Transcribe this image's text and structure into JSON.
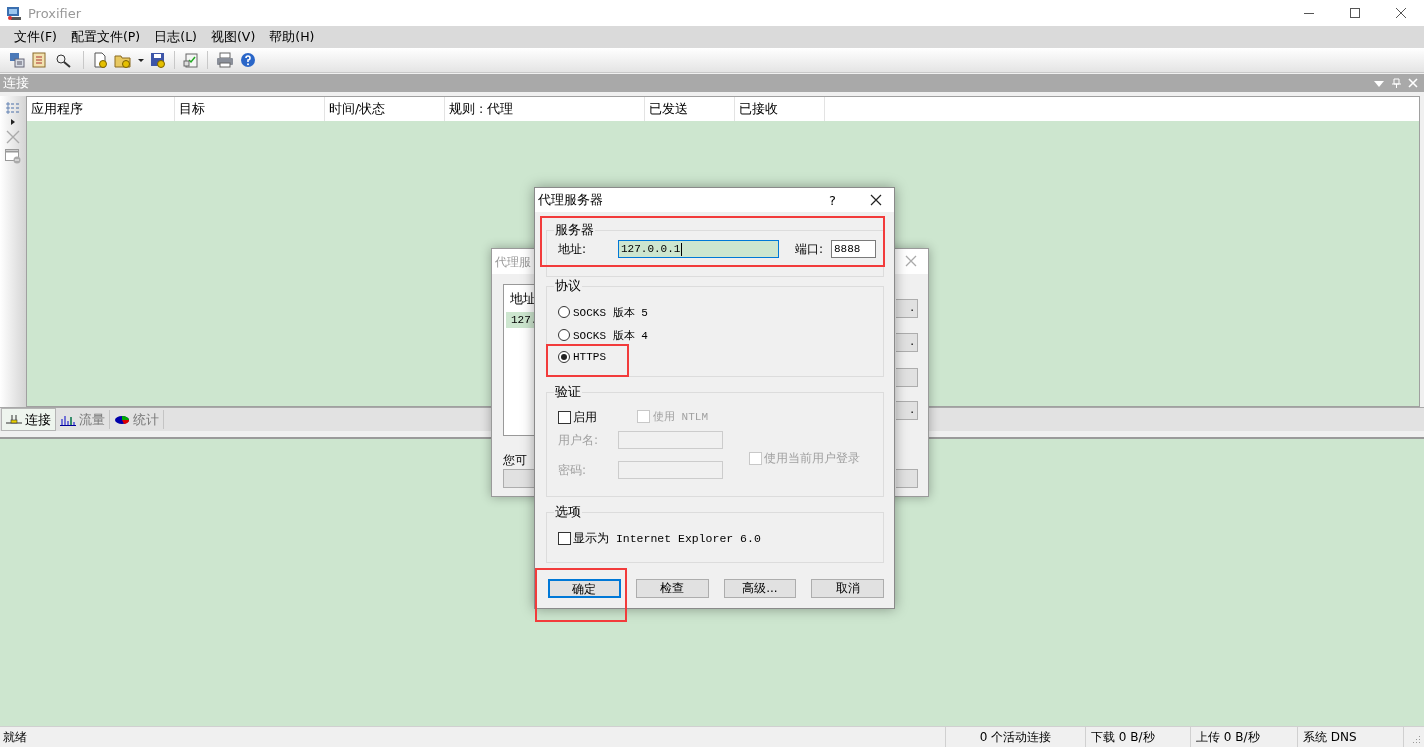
{
  "window": {
    "title": "Proxifier"
  },
  "menu": [
    "文件(F)",
    "配置文件(P)",
    "日志(L)",
    "视图(V)",
    "帮助(H)"
  ],
  "connections_panel": {
    "title": "连接",
    "columns": [
      "应用程序",
      "目标",
      "时间/状态",
      "规则 : 代理",
      "已发送",
      "已接收"
    ]
  },
  "tabs": [
    {
      "label": "连接",
      "selected": true
    },
    {
      "label": "流量",
      "selected": false
    },
    {
      "label": "统计",
      "selected": false
    }
  ],
  "background_dialog": {
    "title": "代理服",
    "list_header": "地址",
    "list_row": "127.",
    "text": "您可",
    "side_buttons": [
      {
        "kind": "labeled",
        "label": "."
      },
      {
        "kind": "labeled",
        "label": "."
      },
      {
        "kind": "blank"
      },
      {
        "kind": "labeled",
        "label": "."
      },
      {
        "kind": "blank"
      }
    ]
  },
  "proxy_dialog": {
    "title": "代理服务器",
    "help": "?",
    "server": {
      "title": "服务器",
      "highlighted": true,
      "address_label": "地址:",
      "address": "127.0.0.1",
      "port_label": "端口:",
      "port": "8888"
    },
    "protocol": {
      "title": "协议",
      "options": [
        {
          "label": "SOCKS 版本 5",
          "selected": false,
          "highlighted": false
        },
        {
          "label": "SOCKS 版本 4",
          "selected": false,
          "highlighted": false
        },
        {
          "label": "HTTPS",
          "selected": true,
          "highlighted": true
        }
      ]
    },
    "auth": {
      "title": "验证",
      "enable": {
        "label": "启用",
        "checked": false,
        "disabled": false
      },
      "ntlm": {
        "label": "使用 NTLM",
        "checked": false,
        "disabled": true
      },
      "username": {
        "label": "用户名:",
        "disabled": true
      },
      "password": {
        "label": "密码:",
        "disabled": true
      },
      "current_user": {
        "label": "使用当前用户登录",
        "checked": false,
        "disabled": true
      }
    },
    "options": {
      "title": "选项",
      "items": [
        {
          "label": "显示为 Internet Explorer 6.0",
          "checked": false
        }
      ]
    },
    "buttons": [
      {
        "label": "确定",
        "default": true,
        "highlighted": true
      },
      {
        "label": "检查",
        "default": false,
        "highlighted": false
      },
      {
        "label": "高级...",
        "default": false,
        "highlighted": false
      },
      {
        "label": "取消",
        "default": false,
        "highlighted": false
      }
    ]
  },
  "status_bar": {
    "status": "就绪",
    "connections": "0 个活动连接",
    "download": "下载 0 B/秒",
    "upload": "上传 0 B/秒",
    "dns": "系统 DNS"
  }
}
